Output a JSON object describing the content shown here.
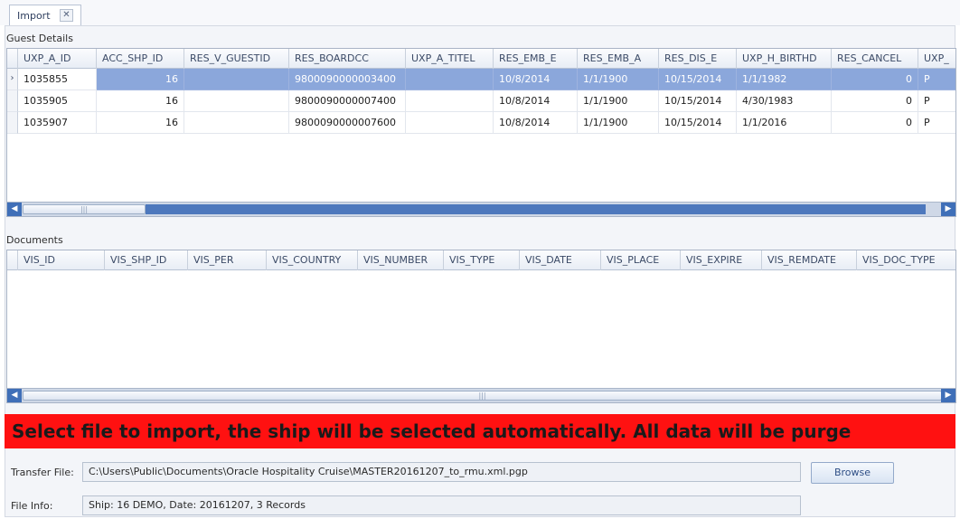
{
  "tab": {
    "label": "Import",
    "close_glyph": "✕"
  },
  "guest_details": {
    "label": "Guest Details",
    "columns": [
      "UXP_A_ID",
      "ACC_SHP_ID",
      "RES_V_GUESTID",
      "RES_BOARDCC",
      "UXP_A_TITEL",
      "RES_EMB_E",
      "RES_EMB_A",
      "RES_DIS_E",
      "UXP_H_BIRTHD",
      "RES_CANCEL",
      "UXP_"
    ],
    "rows": [
      [
        "1035855",
        "16",
        "",
        "9800090000003400",
        "",
        "10/8/2014",
        "1/1/1900",
        "10/15/2014",
        "1/1/1982",
        "0",
        "P"
      ],
      [
        "1035905",
        "16",
        "",
        "9800090000007400",
        "",
        "10/8/2014",
        "1/1/1900",
        "10/15/2014",
        "4/30/1983",
        "0",
        "P"
      ],
      [
        "1035907",
        "16",
        "",
        "9800090000007600",
        "",
        "10/8/2014",
        "1/1/1900",
        "10/15/2014",
        "1/1/2016",
        "0",
        "P"
      ]
    ],
    "selected_row": 0,
    "row_indicator": "›"
  },
  "documents": {
    "label": "Documents",
    "columns": [
      "VIS_ID",
      "VIS_SHP_ID",
      "VIS_PER",
      "VIS_COUNTRY",
      "VIS_NUMBER",
      "VIS_TYPE",
      "VIS_DATE",
      "VIS_PLACE",
      "VIS_EXPIRE",
      "VIS_REMDATE",
      "VIS_DOC_TYPE"
    ]
  },
  "scrollbar": {
    "left_arrow": "◀",
    "right_arrow": "▶",
    "grip": "|||"
  },
  "banner": {
    "text": "Select file to import, the ship will be selected automatically. All data will be purge",
    "color": "#ff1111"
  },
  "transfer_file": {
    "label": "Transfer File:",
    "value": "C:\\Users\\Public\\Documents\\Oracle Hospitality Cruise\\MASTER20161207_to_rmu.xml.pgp"
  },
  "browse_button": {
    "label": "Browse"
  },
  "file_info": {
    "label": "File Info:",
    "value": "Ship: 16 DEMO, Date: 20161207, 3 Records"
  }
}
